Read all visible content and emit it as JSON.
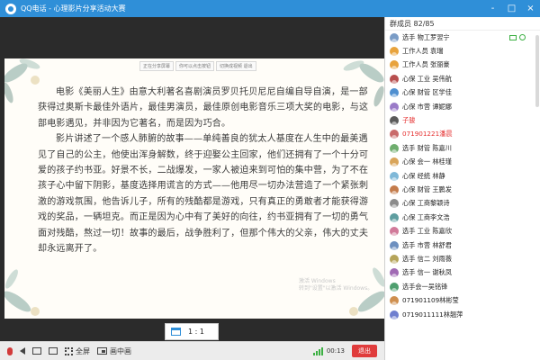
{
  "window": {
    "title": "QQ电话 - 心理影片分享活动大赛",
    "buttons": [
      "-",
      "□",
      "×"
    ]
  },
  "slide": {
    "tabs": [
      "正在分享屏幕",
      "你可以点击按钮",
      "切换成视频 退出"
    ],
    "paragraphs": [
      "电影《美丽人生》由意大利著名喜剧演员罗贝托贝尼尼自编自导自演，是一部获得过奥斯卡最佳外语片，最佳男演员，最佳原创电影音乐三项大奖的电影，与这部电影遇见，并非因为它著名，而是因为巧合。",
      "影片讲述了一个感人肺腑的故事——单纯善良的犹太人基度在人生中的最美遇见了自己的公主，他使出浑身解数，终于迎娶公主回家，他们还拥有了一个十分可爱的孩子约书亚。好景不长，二战爆发，一家人被迫来到可怕的集中营，为了不在孩子心中留下阴影，基度选择用谎言的方式——他用尽一切办法营造了一个紧张刺激的游戏氛围，他告诉儿子，所有的残酷都是游戏，只有真正的勇敢者才能获得游戏的奖品，一辆坦克。而正是因为心中有了美好的向往，约书亚拥有了一切的勇气面对残酷，熬过一切！故事的最后，战争胜利了，但那个伟大的父亲，伟大的丈夫却永远离开了。"
    ],
    "watermark": [
      "激活 Windows",
      "转到\"设置\"以激活 Windows。"
    ]
  },
  "ratio": {
    "label": "1 : 1"
  },
  "toolbar": {
    "fullscreen_label": "全屏",
    "pip_label": "画中画",
    "time": "00:13",
    "exit_label": "退出"
  },
  "panel": {
    "header": "群成员 82/85",
    "members": [
      {
        "name": "选手 物工罗翌宁",
        "color": "#7a9cc6",
        "red": false
      },
      {
        "name": "工作人员 袁瑞",
        "color": "#e8a33d",
        "red": false
      },
      {
        "name": "工作人员 张丽豪",
        "color": "#e8a33d",
        "red": false
      },
      {
        "name": "心保 工业 吴伟航",
        "color": "#b84f4f",
        "red": false
      },
      {
        "name": "心保 财管 区学佳",
        "color": "#4f8fd0",
        "red": false
      },
      {
        "name": "心保 市营 谭妮娜",
        "color": "#9a7bc8",
        "red": false
      },
      {
        "name": "子骏",
        "color": "#5a5a5a",
        "red": true
      },
      {
        "name": "071901221潘晨",
        "color": "#c96b6b",
        "red": true
      },
      {
        "name": "选手 财管 陈嘉川",
        "color": "#6fae6f",
        "red": false
      },
      {
        "name": "心保 会一 林桂瑾",
        "color": "#d9a55a",
        "red": false
      },
      {
        "name": "心保 经统 林静",
        "color": "#7fb8d8",
        "red": false
      },
      {
        "name": "心保 财管 王鹏发",
        "color": "#c47c4c",
        "red": false
      },
      {
        "name": "心保 工商黎颖诗",
        "color": "#8c8c8c",
        "red": false
      },
      {
        "name": "心保 工商李文浩",
        "color": "#5f9ea0",
        "red": false
      },
      {
        "name": "选手 工业 陈嘉欣",
        "color": "#d17a9a",
        "red": false
      },
      {
        "name": "选手 市营 林舒君",
        "color": "#6d8fbf",
        "red": false
      },
      {
        "name": "选手 信二 刘雨薇",
        "color": "#b5a45a",
        "red": false
      },
      {
        "name": "选手 信一 谢秋凤",
        "color": "#a06ab4",
        "red": false
      },
      {
        "name": "选手会一吴铭锋",
        "color": "#4f9f6f",
        "red": false
      },
      {
        "name": "071901109林彬莹",
        "color": "#cf8f4f",
        "red": false
      },
      {
        "name": "0719011111林翘萍",
        "color": "#6f7fcf",
        "red": false
      }
    ]
  },
  "colors": {
    "titlebar": "#2f8fd8",
    "stage": "#2b2b2b",
    "exit": "#e03c3c",
    "highlight_name": "#e53030",
    "active_indicator": "#3cb043"
  }
}
